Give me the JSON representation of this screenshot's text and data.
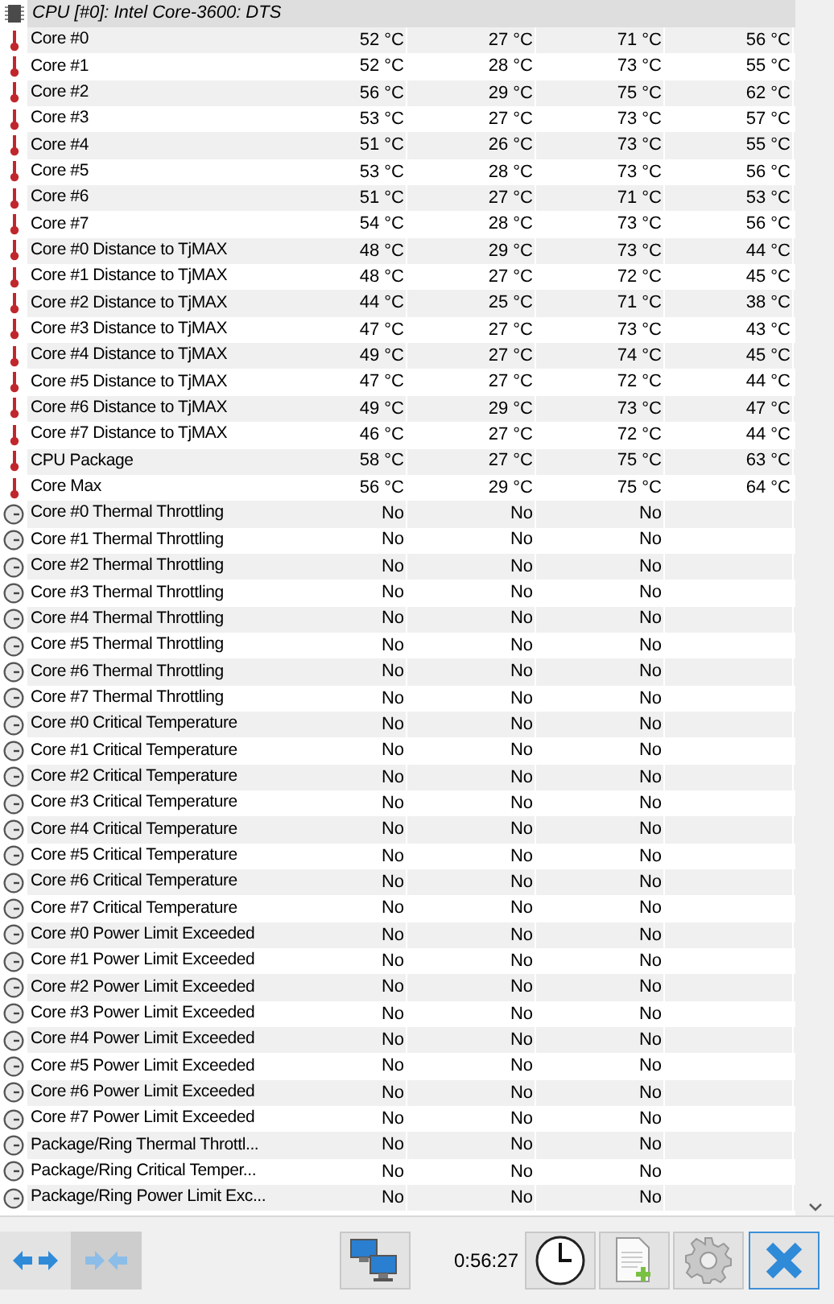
{
  "sensor_group": {
    "title": "CPU [#0]: Intel Core-3600: DTS"
  },
  "rows": [
    {
      "kind": "temperature",
      "label": "Core #0",
      "values": [
        "52 °C",
        "27 °C",
        "71 °C",
        "56 °C"
      ]
    },
    {
      "kind": "temperature",
      "label": "Core #1",
      "values": [
        "52 °C",
        "28 °C",
        "73 °C",
        "55 °C"
      ]
    },
    {
      "kind": "temperature",
      "label": "Core #2",
      "values": [
        "56 °C",
        "29 °C",
        "75 °C",
        "62 °C"
      ]
    },
    {
      "kind": "temperature",
      "label": "Core #3",
      "values": [
        "53 °C",
        "27 °C",
        "73 °C",
        "57 °C"
      ]
    },
    {
      "kind": "temperature",
      "label": "Core #4",
      "values": [
        "51 °C",
        "26 °C",
        "73 °C",
        "55 °C"
      ]
    },
    {
      "kind": "temperature",
      "label": "Core #5",
      "values": [
        "53 °C",
        "28 °C",
        "73 °C",
        "56 °C"
      ]
    },
    {
      "kind": "temperature",
      "label": "Core #6",
      "values": [
        "51 °C",
        "27 °C",
        "71 °C",
        "53 °C"
      ]
    },
    {
      "kind": "temperature",
      "label": "Core #7",
      "values": [
        "54 °C",
        "28 °C",
        "73 °C",
        "56 °C"
      ]
    },
    {
      "kind": "temperature",
      "label": "Core #0 Distance to TjMAX",
      "values": [
        "48 °C",
        "29 °C",
        "73 °C",
        "44 °C"
      ]
    },
    {
      "kind": "temperature",
      "label": "Core #1 Distance to TjMAX",
      "values": [
        "48 °C",
        "27 °C",
        "72 °C",
        "45 °C"
      ]
    },
    {
      "kind": "temperature",
      "label": "Core #2 Distance to TjMAX",
      "values": [
        "44 °C",
        "25 °C",
        "71 °C",
        "38 °C"
      ]
    },
    {
      "kind": "temperature",
      "label": "Core #3 Distance to TjMAX",
      "values": [
        "47 °C",
        "27 °C",
        "73 °C",
        "43 °C"
      ]
    },
    {
      "kind": "temperature",
      "label": "Core #4 Distance to TjMAX",
      "values": [
        "49 °C",
        "27 °C",
        "74 °C",
        "45 °C"
      ]
    },
    {
      "kind": "temperature",
      "label": "Core #5 Distance to TjMAX",
      "values": [
        "47 °C",
        "27 °C",
        "72 °C",
        "44 °C"
      ]
    },
    {
      "kind": "temperature",
      "label": "Core #6 Distance to TjMAX",
      "values": [
        "49 °C",
        "29 °C",
        "73 °C",
        "47 °C"
      ]
    },
    {
      "kind": "temperature",
      "label": "Core #7 Distance to TjMAX",
      "values": [
        "46 °C",
        "27 °C",
        "72 °C",
        "44 °C"
      ]
    },
    {
      "kind": "temperature",
      "label": "CPU Package",
      "values": [
        "58 °C",
        "27 °C",
        "75 °C",
        "63 °C"
      ]
    },
    {
      "kind": "temperature",
      "label": "Core Max",
      "values": [
        "56 °C",
        "29 °C",
        "75 °C",
        "64 °C"
      ]
    },
    {
      "kind": "status",
      "label": "Core #0 Thermal Throttling",
      "values": [
        "No",
        "No",
        "No"
      ]
    },
    {
      "kind": "status",
      "label": "Core #1 Thermal Throttling",
      "values": [
        "No",
        "No",
        "No"
      ]
    },
    {
      "kind": "status",
      "label": "Core #2 Thermal Throttling",
      "values": [
        "No",
        "No",
        "No"
      ]
    },
    {
      "kind": "status",
      "label": "Core #3 Thermal Throttling",
      "values": [
        "No",
        "No",
        "No"
      ]
    },
    {
      "kind": "status",
      "label": "Core #4 Thermal Throttling",
      "values": [
        "No",
        "No",
        "No"
      ]
    },
    {
      "kind": "status",
      "label": "Core #5 Thermal Throttling",
      "values": [
        "No",
        "No",
        "No"
      ]
    },
    {
      "kind": "status",
      "label": "Core #6 Thermal Throttling",
      "values": [
        "No",
        "No",
        "No"
      ]
    },
    {
      "kind": "status",
      "label": "Core #7 Thermal Throttling",
      "values": [
        "No",
        "No",
        "No"
      ]
    },
    {
      "kind": "status",
      "label": "Core #0 Critical Temperature",
      "values": [
        "No",
        "No",
        "No"
      ]
    },
    {
      "kind": "status",
      "label": "Core #1 Critical Temperature",
      "values": [
        "No",
        "No",
        "No"
      ]
    },
    {
      "kind": "status",
      "label": "Core #2 Critical Temperature",
      "values": [
        "No",
        "No",
        "No"
      ]
    },
    {
      "kind": "status",
      "label": "Core #3 Critical Temperature",
      "values": [
        "No",
        "No",
        "No"
      ]
    },
    {
      "kind": "status",
      "label": "Core #4 Critical Temperature",
      "values": [
        "No",
        "No",
        "No"
      ]
    },
    {
      "kind": "status",
      "label": "Core #5 Critical Temperature",
      "values": [
        "No",
        "No",
        "No"
      ]
    },
    {
      "kind": "status",
      "label": "Core #6 Critical Temperature",
      "values": [
        "No",
        "No",
        "No"
      ]
    },
    {
      "kind": "status",
      "label": "Core #7 Critical Temperature",
      "values": [
        "No",
        "No",
        "No"
      ]
    },
    {
      "kind": "status",
      "label": "Core #0 Power Limit Exceeded",
      "values": [
        "No",
        "No",
        "No"
      ]
    },
    {
      "kind": "status",
      "label": "Core #1 Power Limit Exceeded",
      "values": [
        "No",
        "No",
        "No"
      ]
    },
    {
      "kind": "status",
      "label": "Core #2 Power Limit Exceeded",
      "values": [
        "No",
        "No",
        "No"
      ]
    },
    {
      "kind": "status",
      "label": "Core #3 Power Limit Exceeded",
      "values": [
        "No",
        "No",
        "No"
      ]
    },
    {
      "kind": "status",
      "label": "Core #4 Power Limit Exceeded",
      "values": [
        "No",
        "No",
        "No"
      ]
    },
    {
      "kind": "status",
      "label": "Core #5 Power Limit Exceeded",
      "values": [
        "No",
        "No",
        "No"
      ]
    },
    {
      "kind": "status",
      "label": "Core #6 Power Limit Exceeded",
      "values": [
        "No",
        "No",
        "No"
      ]
    },
    {
      "kind": "status",
      "label": "Core #7 Power Limit Exceeded",
      "values": [
        "No",
        "No",
        "No"
      ]
    },
    {
      "kind": "status",
      "label": "Package/Ring Thermal Throttl...",
      "values": [
        "No",
        "No",
        "No"
      ]
    },
    {
      "kind": "status",
      "label": "Package/Ring Critical Temper...",
      "values": [
        "No",
        "No",
        "No"
      ]
    },
    {
      "kind": "status",
      "label": "Package/Ring Power Limit Exc...",
      "values": [
        "No",
        "No",
        "No"
      ]
    }
  ],
  "toolbar": {
    "expand_selected": false,
    "collapse_selected": true,
    "elapsed_time": "0:56:27"
  }
}
